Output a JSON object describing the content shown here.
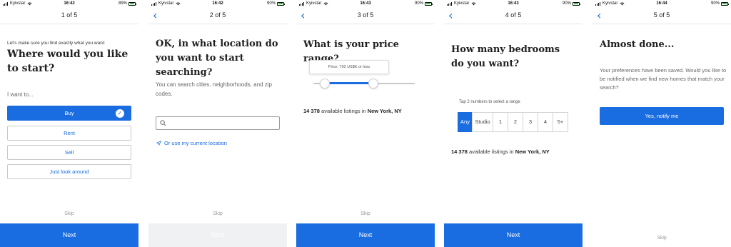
{
  "status_bar": {
    "carrier": "Kyivstar",
    "screens": [
      {
        "time": "16:42",
        "battery": "89%",
        "battery_level": 0.89
      },
      {
        "time": "16:42",
        "battery": "90%",
        "battery_level": 0.9
      },
      {
        "time": "16:43",
        "battery": "90%",
        "battery_level": 0.9
      },
      {
        "time": "16:43",
        "battery": "90%",
        "battery_level": 0.9
      },
      {
        "time": "16:44",
        "battery": "90%",
        "battery_level": 0.9
      }
    ]
  },
  "colors": {
    "accent": "#1a6de0",
    "disabled": "#f0f1f3",
    "battery": "#3cc04a"
  },
  "icons": {
    "back": "chevron-left-icon",
    "search": "search-icon",
    "location": "location-arrow-icon",
    "check": "check-circle-icon",
    "wifi": "wifi-icon"
  },
  "common": {
    "next": "Next",
    "skip": "Skip"
  },
  "screen1": {
    "step": "1 of 5",
    "intro": "Let's make sure you find exactly what you want:",
    "title": "Where would you like to start?",
    "label": "I want to...",
    "options": [
      "Buy",
      "Rent",
      "Sell",
      "Just look around"
    ],
    "selected_option": "Buy"
  },
  "screen2": {
    "step": "2 of 5",
    "title": "OK, in what location do you want to start searching?",
    "description": "You can search cities, neighborhoods, and zip codes.",
    "search": {
      "value": "",
      "placeholder": ""
    },
    "location_link": "Or use my current location",
    "next_enabled": false
  },
  "screen3": {
    "step": "3 of 5",
    "title": "What is your price range?",
    "price_tooltip": "Price: 750 US$K or less",
    "slider": {
      "low": 0.11,
      "high": 0.59
    },
    "listings_count": "14 378",
    "listings_text": "available listings in",
    "location": "New York, NY"
  },
  "screen4": {
    "step": "4 of 5",
    "title": "How many bedrooms do you want?",
    "hint": "Tap 2 numbers to select a range",
    "options": [
      "Any",
      "Studio",
      "1",
      "2",
      "3",
      "4",
      "5+"
    ],
    "selected": "Any",
    "listings_count": "14 378",
    "listings_text": "available listings in",
    "location": "New York, NY"
  },
  "screen5": {
    "step": "5 of 5",
    "title": "Almost done...",
    "description": "Your preferences have been saved. Would you like to be notified when we find new homes that match your search?",
    "notify_button": "Yes, notify me"
  }
}
